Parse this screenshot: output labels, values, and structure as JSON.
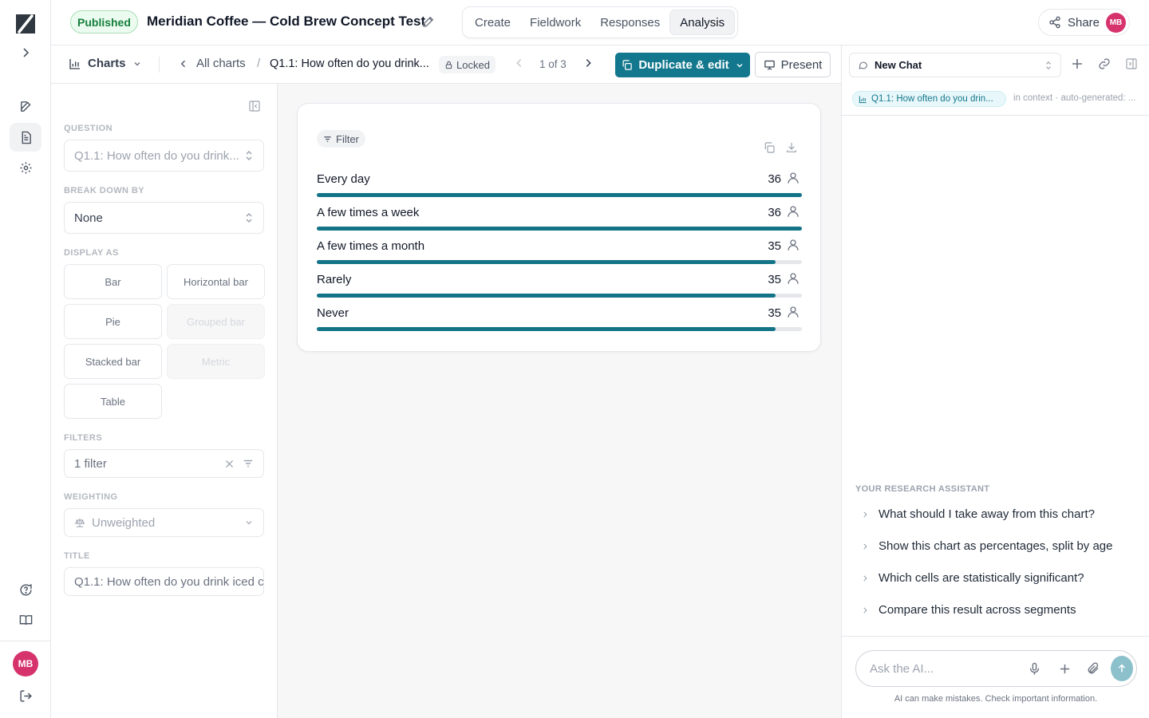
{
  "header": {
    "status_badge": "Published",
    "project_title": "Meridian Coffee — Cold Brew Concept Test",
    "tabs": [
      {
        "label": "Create"
      },
      {
        "label": "Fieldwork"
      },
      {
        "label": "Responses"
      },
      {
        "label": "Analysis",
        "active": true
      }
    ],
    "share_label": "Share",
    "user_initials": "MB"
  },
  "toolbar": {
    "charts_label": "Charts",
    "all_charts_label": "All charts",
    "breadcrumb_current": "Q1.1: How often do you drink...",
    "locked_label": "Locked",
    "pager": "1 of 3",
    "duplicate_label": "Duplicate & edit",
    "present_label": "Present"
  },
  "settings": {
    "question_label": "QUESTION",
    "question_value": "Q1.1: How often do you drink...",
    "breakdown_label": "BREAK DOWN BY",
    "breakdown_value": "None",
    "display_label": "DISPLAY AS",
    "display_options": [
      {
        "label": "Bar",
        "enabled": true
      },
      {
        "label": "Horizontal bar",
        "enabled": true
      },
      {
        "label": "Pie",
        "enabled": true
      },
      {
        "label": "Grouped bar",
        "enabled": false
      },
      {
        "label": "Stacked bar",
        "enabled": true
      },
      {
        "label": "Metric",
        "enabled": false
      },
      {
        "label": "Table",
        "enabled": true
      }
    ],
    "filters_label": "FILTERS",
    "filters_value": "1 filter",
    "weighting_label": "WEIGHTING",
    "weighting_value": "Unweighted",
    "title_label": "TITLE",
    "title_value": "Q1.1: How often do you drink iced c"
  },
  "chart": {
    "filter_chip": "Filter"
  },
  "chart_data": {
    "type": "bar",
    "categories": [
      "Every day",
      "A few times a week",
      "A few times a month",
      "Rarely",
      "Never"
    ],
    "values": [
      36,
      36,
      35,
      35,
      35
    ],
    "xlim": [
      0,
      36
    ],
    "accent_color": "#147487"
  },
  "chat": {
    "selector_label": "New Chat",
    "context_pill": "Q1.1: How often do you drin...",
    "context_note": "in context · auto-generated: ...",
    "assistant_label": "YOUR RESEARCH ASSISTANT",
    "suggestions": [
      "What should I take away from this chart?",
      "Show this chart as percentages, split by age",
      "Which cells are statistically significant?",
      "Compare this result across segments"
    ],
    "input_placeholder": "Ask the AI...",
    "disclaimer": "AI can make mistakes. Check important information."
  },
  "colors": {
    "brand": "#13788d",
    "published_green": "#15803d",
    "avatar": "#d6336c"
  }
}
